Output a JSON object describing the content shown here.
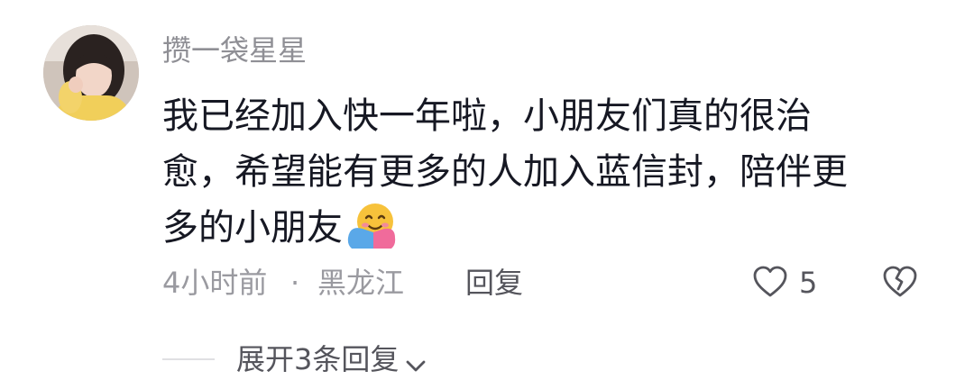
{
  "comment": {
    "username": "攒一袋星星",
    "text_lines": [
      "我已经加入快一年啦，小朋友们真的很治",
      "愈，希望能有更多的人加入蓝信封，陪伴更",
      "多的小朋友"
    ],
    "emoji": "hugging-face-emoji",
    "time": "4小时前",
    "separator": "·",
    "location": "黑龙江",
    "reply_label": "回复",
    "like_count": "5"
  },
  "replies": {
    "expand_label": "展开3条回复"
  },
  "colors": {
    "text_primary": "#161823",
    "text_secondary": "#8f8f95",
    "action_text": "#55555c",
    "divider": "#e0e0e3",
    "background": "#ffffff"
  }
}
